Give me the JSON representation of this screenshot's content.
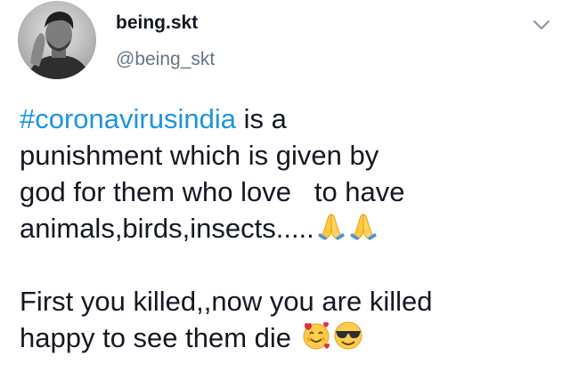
{
  "author": {
    "display_name": "being.skt",
    "handle": "@being_skt"
  },
  "tweet": {
    "hashtag": "#coronavirusindia",
    "line1_rest": " is a",
    "line2": "punishment which is given by",
    "line3": "god for them who love   to have",
    "line4": "animals,birds,insects.....",
    "line5": "First you killed,,now you are killed",
    "line6": "happy to see them die",
    "line4_emojis": [
      "folded-hands-icon",
      "folded-hands-icon"
    ],
    "line6_emojis": [
      "smiling-face-with-hearts-icon",
      "smiling-face-with-sunglasses-icon"
    ]
  },
  "colors": {
    "hashtag": "#1b95e0",
    "text": "#141823",
    "handle": "#657786",
    "background": "#ffffff"
  },
  "icons": {
    "menu": "chevron-down-icon"
  }
}
